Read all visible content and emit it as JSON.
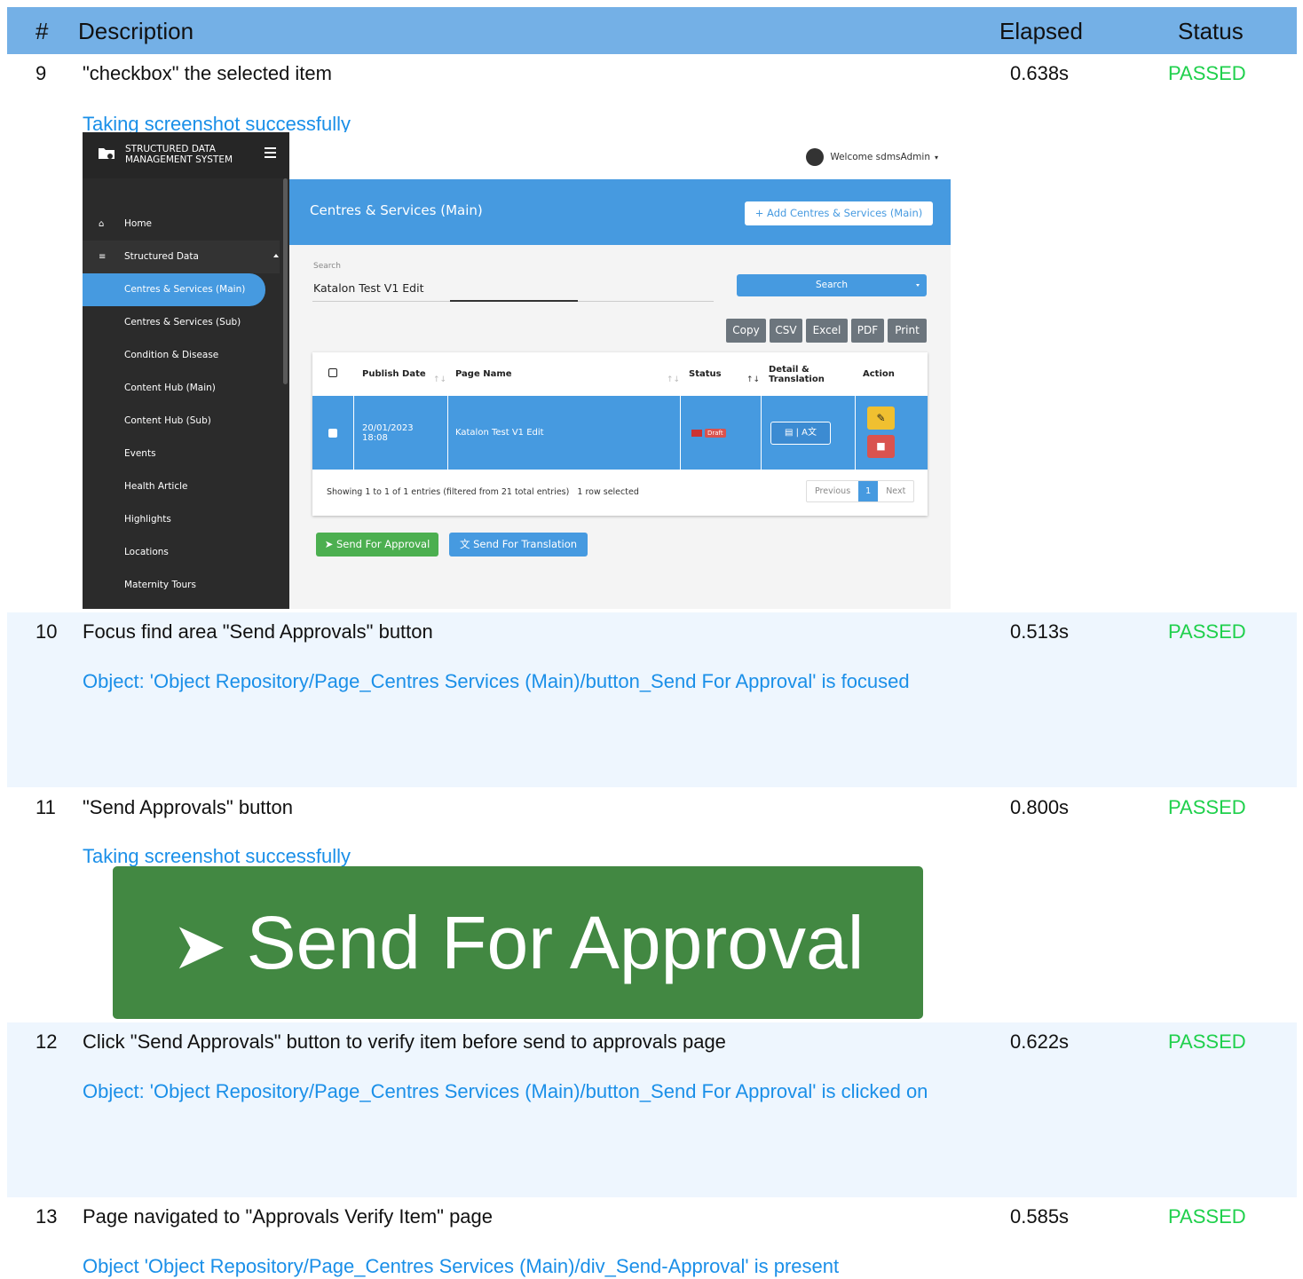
{
  "header": {
    "num": "#",
    "description": "Description",
    "elapsed": "Elapsed",
    "status": "Status"
  },
  "steps": [
    {
      "num": "9",
      "description": "\"checkbox\" the selected item",
      "elapsed": "0.638s",
      "status": "PASSED",
      "message": "Taking screenshot successfully"
    },
    {
      "num": "10",
      "description": "Focus find area \"Send Approvals\" button",
      "elapsed": "0.513s",
      "status": "PASSED",
      "message": "Object: 'Object Repository/Page_Centres  Services (Main)/button_Send For Approval' is focused"
    },
    {
      "num": "11",
      "description": "\"Send Approvals\" button",
      "elapsed": "0.800s",
      "status": "PASSED",
      "message": "Taking screenshot successfully"
    },
    {
      "num": "12",
      "description": "Click \"Send Approvals\" button to verify item before send to approvals page",
      "elapsed": "0.622s",
      "status": "PASSED",
      "message": "Object: 'Object Repository/Page_Centres  Services (Main)/button_Send For Approval' is clicked on"
    },
    {
      "num": "13",
      "description": "Page navigated to \"Approvals Verify Item\" page",
      "elapsed": "0.585s",
      "status": "PASSED",
      "message": "Object 'Object Repository/Page_Centres  Services (Main)/div_Send-Approval' is present"
    }
  ],
  "app": {
    "brand_line1": "STRUCTURED DATA",
    "brand_line2": "MANAGEMENT SYSTEM",
    "welcome": "Welcome sdmsAdmin",
    "sidebar": [
      "Home",
      "Structured Data",
      "Centres & Services (Main)",
      "Centres & Services (Sub)",
      "Condition & Disease",
      "Content Hub (Main)",
      "Content Hub (Sub)",
      "Events",
      "Health Article",
      "Highlights",
      "Locations",
      "Maternity Tours"
    ],
    "page_title": "Centres & Services (Main)",
    "add_button": "Add Centres & Services (Main)",
    "search_label": "Search",
    "search_value": "Katalon Test V1 Edit",
    "search_button": "Search",
    "export": [
      "Copy",
      "CSV",
      "Excel",
      "PDF",
      "Print"
    ],
    "columns": [
      "Publish Date",
      "Page Name",
      "Status",
      "Detail &",
      "Translation",
      "Action"
    ],
    "row": {
      "date": "20/01/2023",
      "time": "18:08",
      "page_name": "Katalon Test V1 Edit",
      "status": "Draft",
      "translate_icon": "A文"
    },
    "info": "Showing 1 to 1 of 1 entries (filtered from 21 total entries)",
    "selected": "1 row selected",
    "pager": {
      "prev": "Previous",
      "page": "1",
      "next": "Next"
    },
    "send_approval": "Send For Approval",
    "send_translation": "Send For Translation"
  },
  "zoom_button": "Send For Approval",
  "colors": {
    "header": "#74b0e6",
    "passed": "#1fd04c",
    "link": "#1a8fe8",
    "primary": "#469ae0",
    "approve": "#428842"
  }
}
